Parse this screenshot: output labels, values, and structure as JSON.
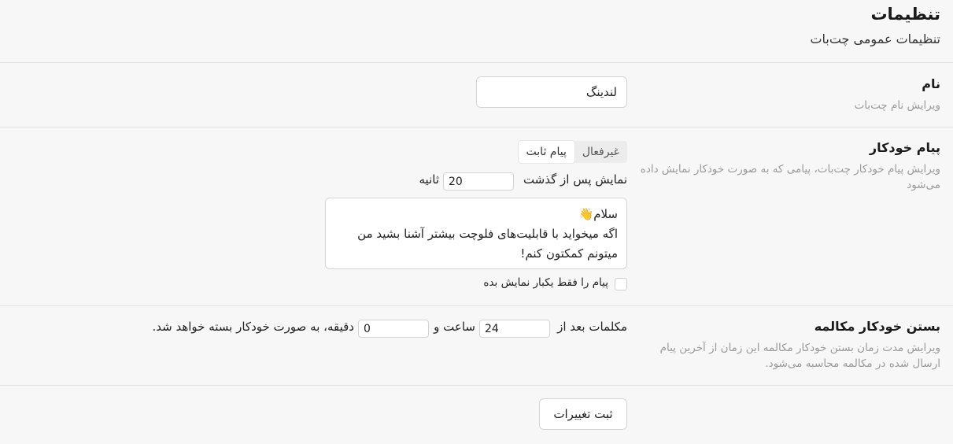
{
  "header": {
    "title": "تنظیمات",
    "subtitle": "تنظیمات عمومی چت‌بات"
  },
  "name_section": {
    "title": "نام",
    "description": "ویرایش نام چت‌بات",
    "value": "لندینگ"
  },
  "auto_message": {
    "title": "پیام خودکار",
    "description": "ویرایش پیام خودکار چت‌بات، پیامی که به صورت خودکار نمایش داده می‌شود",
    "tabs": [
      {
        "label": "غیرفعال",
        "active": false
      },
      {
        "label": "پیام ثابت",
        "active": true
      }
    ],
    "delay_prefix": "نمایش پس از گذشت",
    "delay_value": "20",
    "delay_suffix": "ثانیه",
    "message_lines": [
      "سلام👋",
      "اگه میخواید با قابلیت‌های فلوچت بیشتر آشنا بشید من",
      "میتونم کمکتون کنم!"
    ],
    "show_once_label": "پیام را فقط یکبار نمایش بده",
    "show_once_checked": false
  },
  "auto_close": {
    "title": "بستن خودکار مکالمه",
    "description": "ویرایش مدت زمان بستن خودکار مکالمه این زمان از آخرین پیام ارسال شده در مکالمه محاسبه می‌شود.",
    "text_before_hours": "مکلمات بعد از",
    "hours_value": "24",
    "text_after_hours": "ساعت و",
    "minutes_value": "0",
    "text_after_minutes": "دقیقه، به صورت خودکار بسته خواهد شد."
  },
  "actions": {
    "save_label": "ثبت تغییرات"
  },
  "colors": {
    "background": "#f7f7f7",
    "divider": "#e3e3e3",
    "muted_text": "#9a9a9a"
  }
}
